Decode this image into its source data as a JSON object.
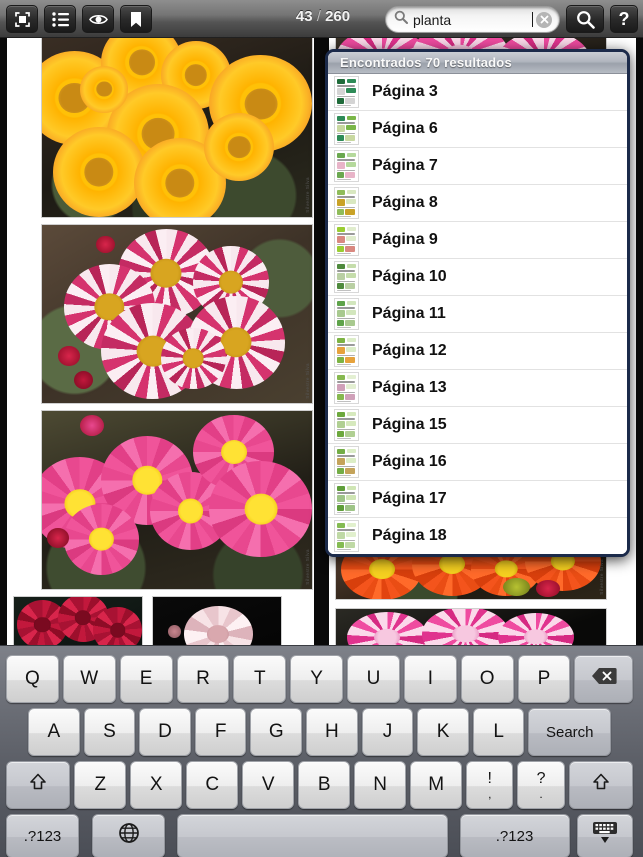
{
  "toolbar": {
    "buttons": [
      {
        "name": "fullscreen-icon",
        "label": "Fullscreen"
      },
      {
        "name": "contents-list-icon",
        "label": "Contents"
      },
      {
        "name": "eye-icon",
        "label": "View"
      },
      {
        "name": "bookmark-icon",
        "label": "Bookmark"
      }
    ],
    "page_indicator": {
      "current": "43",
      "separator": "/",
      "total": "260"
    },
    "search": {
      "value": "planta",
      "placeholder": "",
      "search_icon": "magnifier-icon",
      "clear_icon": "clear-circle-icon"
    },
    "search_button": {
      "name": "search-button",
      "icon": "magnifier-icon"
    },
    "help_button": {
      "name": "help-button",
      "label": "?"
    }
  },
  "results_popup": {
    "header": "Encontrados 70 resultados",
    "rows": [
      {
        "label": "Página 3"
      },
      {
        "label": "Página 6"
      },
      {
        "label": "Página 7"
      },
      {
        "label": "Página 8"
      },
      {
        "label": "Página 9"
      },
      {
        "label": "Página 10"
      },
      {
        "label": "Página 11"
      },
      {
        "label": "Página 12"
      },
      {
        "label": "Página 13"
      },
      {
        "label": "Página 15"
      },
      {
        "label": "Página 16"
      },
      {
        "label": "Página 17"
      },
      {
        "label": "Página 18"
      }
    ]
  },
  "reader": {
    "photo_credit": "Silvestre Silva",
    "photos": [
      {
        "name": "photo-yellow-chrysanthemums",
        "alt": "Yellow chrysanthemum flowers"
      },
      {
        "name": "photo-pink-white-striped-chrysanthemums",
        "alt": "Pink and white striped chrysanthemums"
      },
      {
        "name": "photo-hot-pink-chrysanthemums",
        "alt": "Hot pink chrysanthemums with yellow centers"
      },
      {
        "name": "photo-dark-red-chrysanthemums",
        "alt": "Dark red chrysanthemums"
      },
      {
        "name": "photo-pale-blush-bloom",
        "alt": "Pale blush bloom on black background"
      },
      {
        "name": "photo-magenta-chrysanthemums-top",
        "alt": "Magenta chrysanthemums"
      },
      {
        "name": "photo-orange-chrysanthemums",
        "alt": "Orange chrysanthemums"
      },
      {
        "name": "photo-magenta-spider-chrysanthemums",
        "alt": "Magenta spider chrysanthemums"
      }
    ]
  },
  "keyboard": {
    "row1": [
      {
        "label": "Q",
        "name": "key-q"
      },
      {
        "label": "W",
        "name": "key-w"
      },
      {
        "label": "E",
        "name": "key-e"
      },
      {
        "label": "R",
        "name": "key-r"
      },
      {
        "label": "T",
        "name": "key-t"
      },
      {
        "label": "Y",
        "name": "key-y"
      },
      {
        "label": "U",
        "name": "key-u"
      },
      {
        "label": "I",
        "name": "key-i"
      },
      {
        "label": "O",
        "name": "key-o"
      },
      {
        "label": "P",
        "name": "key-p"
      }
    ],
    "backspace": {
      "name": "key-backspace",
      "icon": "backspace-icon"
    },
    "row2": [
      {
        "label": "A",
        "name": "key-a"
      },
      {
        "label": "S",
        "name": "key-s"
      },
      {
        "label": "D",
        "name": "key-d"
      },
      {
        "label": "F",
        "name": "key-f"
      },
      {
        "label": "G",
        "name": "key-g"
      },
      {
        "label": "H",
        "name": "key-h"
      },
      {
        "label": "J",
        "name": "key-j"
      },
      {
        "label": "K",
        "name": "key-k"
      },
      {
        "label": "L",
        "name": "key-l"
      }
    ],
    "search_key": {
      "label": "Search",
      "name": "key-search"
    },
    "row3": [
      {
        "label": "Z",
        "name": "key-z"
      },
      {
        "label": "X",
        "name": "key-x"
      },
      {
        "label": "C",
        "name": "key-c"
      },
      {
        "label": "V",
        "name": "key-v"
      },
      {
        "label": "B",
        "name": "key-b"
      },
      {
        "label": "N",
        "name": "key-n"
      },
      {
        "label": "M",
        "name": "key-m"
      }
    ],
    "punct1": {
      "top": "!",
      "bottom": ",",
      "name": "key-exclam-comma"
    },
    "punct2": {
      "top": "?",
      "bottom": ".",
      "name": "key-question-period"
    },
    "shift_left": {
      "name": "key-shift-left",
      "icon": "shift-arrow-icon"
    },
    "shift_right": {
      "name": "key-shift-right",
      "icon": "shift-arrow-icon"
    },
    "num_left": {
      "label": ".?123",
      "name": "key-numbers-left"
    },
    "num_right": {
      "label": ".?123",
      "name": "key-numbers-right"
    },
    "globe": {
      "name": "key-globe",
      "icon": "globe-icon"
    },
    "space": {
      "label": "",
      "name": "key-space"
    },
    "dismiss": {
      "name": "key-dismiss-keyboard",
      "icon": "keyboard-dismiss-icon"
    }
  },
  "colors": {
    "popup_border": "#1b2a4a",
    "toolbar_top": "#8e8e8e",
    "toolbar_bottom": "#3c3c3c",
    "keyboard_bg": "#6f727a",
    "key_face": "#eeeeee"
  }
}
